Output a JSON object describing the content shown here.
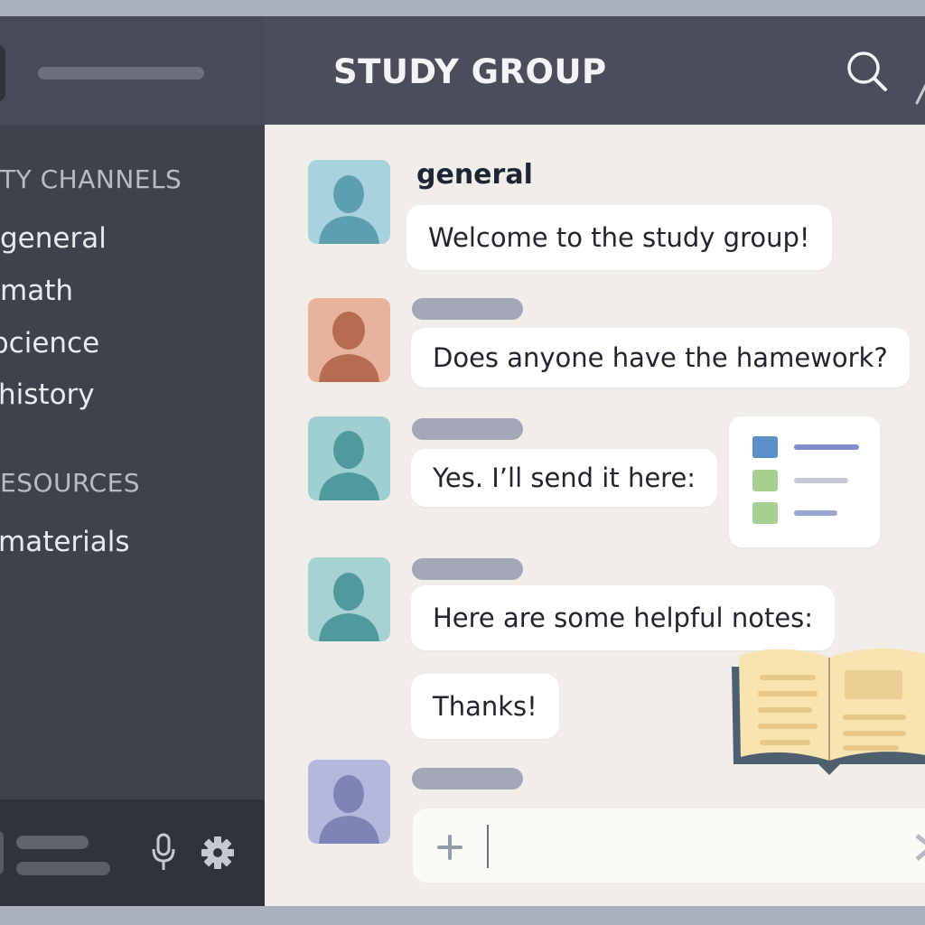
{
  "app": {
    "room_title": "STUDY GROUP"
  },
  "sidebar": {
    "categories": [
      {
        "label": "TY CHANNELS"
      },
      {
        "label": "ESOURCES"
      }
    ],
    "channels": [
      {
        "label": "general"
      },
      {
        "label": "math"
      },
      {
        "label": "bcience"
      },
      {
        "label": "history"
      },
      {
        "label": "materials"
      }
    ],
    "user_bar": {
      "mic_icon": "microphone-icon",
      "settings_icon": "gear-icon"
    }
  },
  "header": {
    "search_icon": "search-icon"
  },
  "chat": {
    "channel_name": "general",
    "messages": [
      {
        "text": "Welcome to the study group!",
        "avatar_color": "#7fb6c7"
      },
      {
        "text": "Does anyone have the hamework?",
        "avatar_color": "#c9765b"
      },
      {
        "text": "Yes. I’ll send it here:",
        "avatar_color": "#5f9ea6"
      },
      {
        "text": "Here are some helpful notes:",
        "avatar_color": "#5f9ea6"
      },
      {
        "text": "Thanks!"
      }
    ],
    "attachment_icons": [
      "document-card-icon",
      "open-book-icon"
    ]
  },
  "composer": {
    "placeholder": "",
    "value": "",
    "add_icon": "plus-icon",
    "send_icon": "send-icon"
  },
  "colors": {
    "sidebar_bg": "#3f424d",
    "header_bg": "#4a4e5b",
    "chat_bg": "#f1eeea",
    "bubble_bg": "#ffffff",
    "name_placeholder": "#a3a7b8"
  }
}
